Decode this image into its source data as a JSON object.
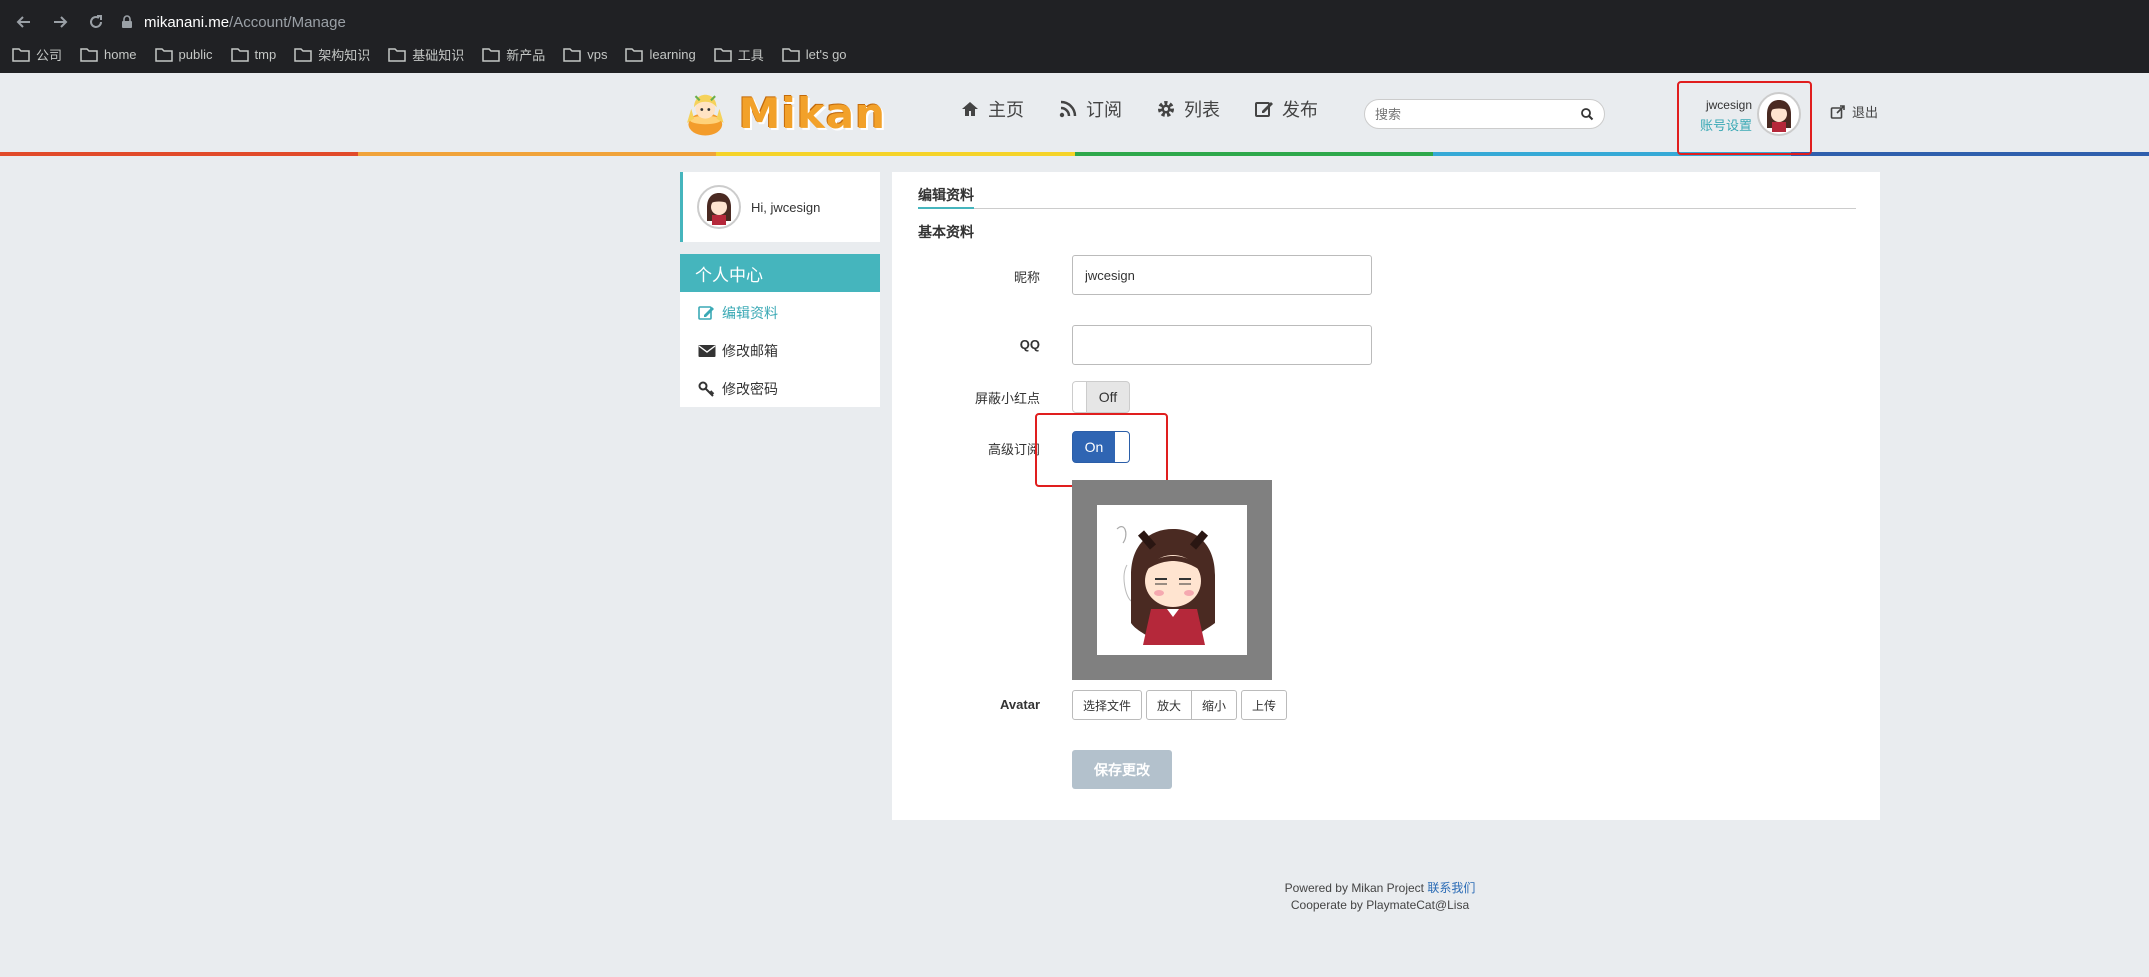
{
  "browser": {
    "url_host": "mikanani.me",
    "url_path": "/Account/Manage",
    "bookmarks": [
      "公司",
      "home",
      "public",
      "tmp",
      "架构知识",
      "基础知识",
      "新产品",
      "vps",
      "learning",
      "工具",
      "let's go"
    ]
  },
  "site": {
    "logo_text": "Mikan",
    "nav": [
      {
        "label": "主页",
        "icon": "home-icon"
      },
      {
        "label": "订阅",
        "icon": "rss-icon"
      },
      {
        "label": "列表",
        "icon": "gear-icon"
      },
      {
        "label": "发布",
        "icon": "edit-icon"
      }
    ],
    "search_placeholder": "搜索",
    "user_name": "jwcesign",
    "account_settings": "账号设置",
    "logout": "退出",
    "rainbow_colors": [
      "#e14a2a",
      "#f0a33a",
      "#f5d328",
      "#2ea84b",
      "#35a9d6",
      "#2f5fad"
    ]
  },
  "sidebar": {
    "greeting": "Hi, jwcesign",
    "menu_title": "个人中心",
    "items": [
      {
        "label": "编辑资料",
        "active": true
      },
      {
        "label": "修改邮箱",
        "active": false
      },
      {
        "label": "修改密码",
        "active": false
      }
    ]
  },
  "form": {
    "tab_title": "编辑资料",
    "section_title": "基本资料",
    "nickname_label": "昵称",
    "nickname_value": "jwcesign",
    "qq_label": "QQ",
    "qq_value": "",
    "hide_dot_label": "屏蔽小红点",
    "hide_dot_state": "Off",
    "advanced_sub_label": "高级订阅",
    "advanced_sub_state": "On",
    "avatar_label": "Avatar",
    "buttons": [
      "选择文件",
      "放大",
      "缩小",
      "上传"
    ],
    "save_label": "保存更改"
  },
  "footer": {
    "line1": "Powered by Mikan Project",
    "contact": "联系我们",
    "line2": "Cooperate by PlaymateCat@Lisa"
  }
}
